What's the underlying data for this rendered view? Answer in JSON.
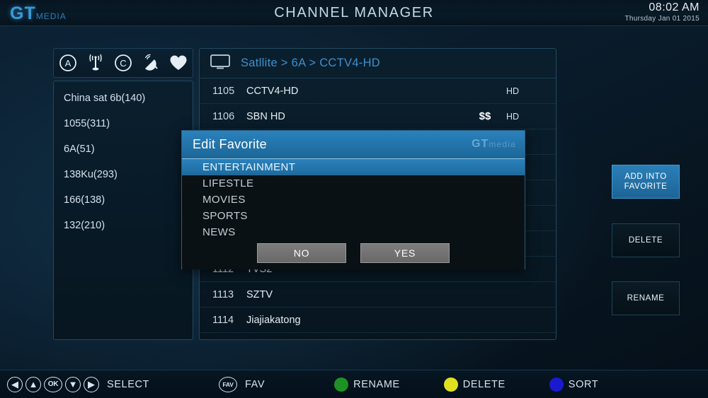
{
  "header": {
    "logo_gt": "GT",
    "logo_media": "media",
    "title": "CHANNEL MANAGER",
    "time": "08:02 AM",
    "date": "Thursday  Jan 01 2015"
  },
  "icon_bar": {
    "icons": [
      {
        "name": "circled-a-icon",
        "label": "A"
      },
      {
        "name": "antenna-icon",
        "label": "Antenna"
      },
      {
        "name": "circled-c-icon",
        "label": "C"
      },
      {
        "name": "satellite-dish-icon",
        "label": "Dish"
      },
      {
        "name": "heart-icon",
        "label": "Favorite"
      }
    ]
  },
  "sidebar": {
    "items": [
      {
        "label": "China sat 6b(140)"
      },
      {
        "label": "1055(311)"
      },
      {
        "label": "6A(51)"
      },
      {
        "label": "138Ku(293)"
      },
      {
        "label": "166(138)"
      },
      {
        "label": "132(210)"
      }
    ]
  },
  "channel_panel": {
    "breadcrumb": "Satllite > 6A > CCTV4-HD",
    "tv_icon": "tv-icon",
    "rows": [
      {
        "num": "1105",
        "name": "CCTV4-HD",
        "pay": "",
        "hd": "HD"
      },
      {
        "num": "1106",
        "name": "SBN HD",
        "pay": "$$",
        "hd": "HD"
      },
      {
        "num": "1112",
        "name": "TVS2",
        "pay": "",
        "hd": ""
      },
      {
        "num": "1113",
        "name": "SZTV",
        "pay": "",
        "hd": ""
      },
      {
        "num": "1114",
        "name": "Jiajiakatong",
        "pay": "",
        "hd": ""
      }
    ]
  },
  "actions": {
    "add_favorite": "ADD INTO FAVORITE",
    "delete": "DELETE",
    "rename": "RENAME"
  },
  "dialog": {
    "title": "Edit Favorite",
    "logo_gt": "GT",
    "logo_media": "media",
    "items": [
      {
        "label": "ENTERTAINMENT",
        "selected": true
      },
      {
        "label": "LIFESTLE",
        "selected": false
      },
      {
        "label": "MOVIES",
        "selected": false
      },
      {
        "label": "SPORTS",
        "selected": false
      },
      {
        "label": "NEWS",
        "selected": false
      }
    ],
    "no_label": "NO",
    "yes_label": "YES"
  },
  "bottom_bar": {
    "select_label": "SELECT",
    "fav_key": "FAV",
    "fav_label": "FAV",
    "ok_key": "OK",
    "color_keys": [
      {
        "label": "RENAME",
        "color": "#1d9123"
      },
      {
        "label": "DELETE",
        "color": "#e0e020"
      },
      {
        "label": "SORT",
        "color": "#1a1ad0"
      }
    ]
  }
}
